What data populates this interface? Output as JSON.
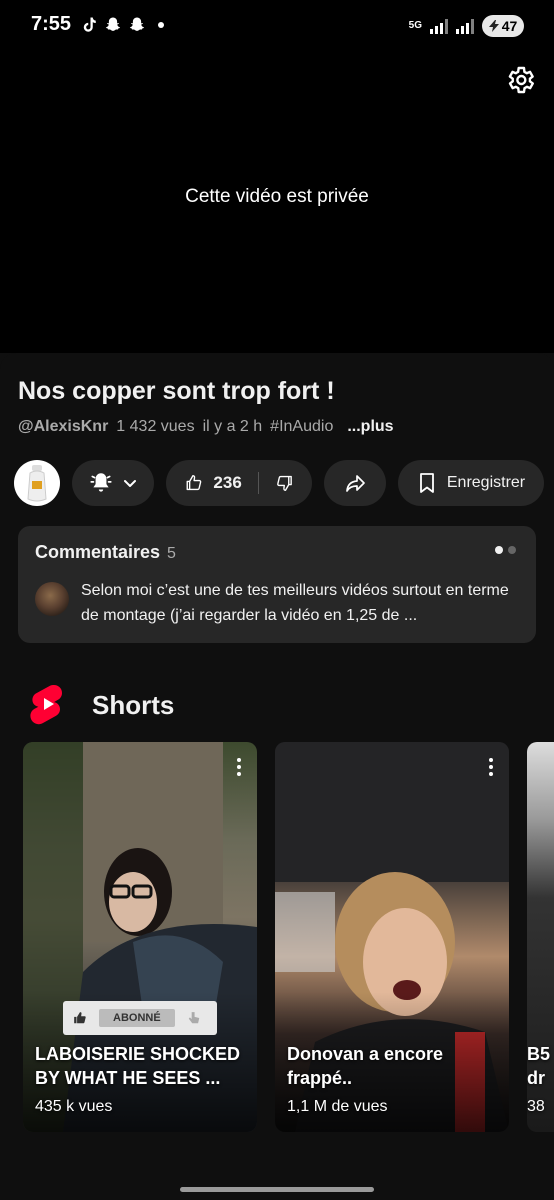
{
  "status_bar": {
    "time": "7:55",
    "network": "5G",
    "battery": "47",
    "app_icons": [
      "tiktok-icon",
      "snapchat-icon",
      "snapchat-icon"
    ]
  },
  "player": {
    "message": "Cette vidéo est privée"
  },
  "video": {
    "title": "Nos copper sont trop fort !",
    "channel": "@AlexisKnr",
    "views": "1 432 vues",
    "age": "il y a 2 h",
    "hashtag": "#InAudio",
    "more": "...plus"
  },
  "actions": {
    "likes": "236",
    "save_label": "Enregistrer"
  },
  "comments": {
    "title": "Commentaires",
    "count": "5",
    "preview": "Selon moi c’est une de tes meilleurs vidéos surtout en terme de montage (j’ai regarder la vidéo en 1,25 de ..."
  },
  "shorts": {
    "title": "Shorts",
    "items": [
      {
        "title": "LABOISERIE SHOCKED BY WHAT HE SEES ...",
        "views": "435 k vues",
        "overlay_label": "ABONNÉ"
      },
      {
        "title": "Donovan a encore frappé..",
        "views": "1,1 M de vues"
      },
      {
        "title": "B5 dr",
        "views": "38"
      }
    ]
  },
  "colors": {
    "background": "#0f0f0f",
    "pill": "#272727",
    "shorts_red": "#ff0033"
  }
}
